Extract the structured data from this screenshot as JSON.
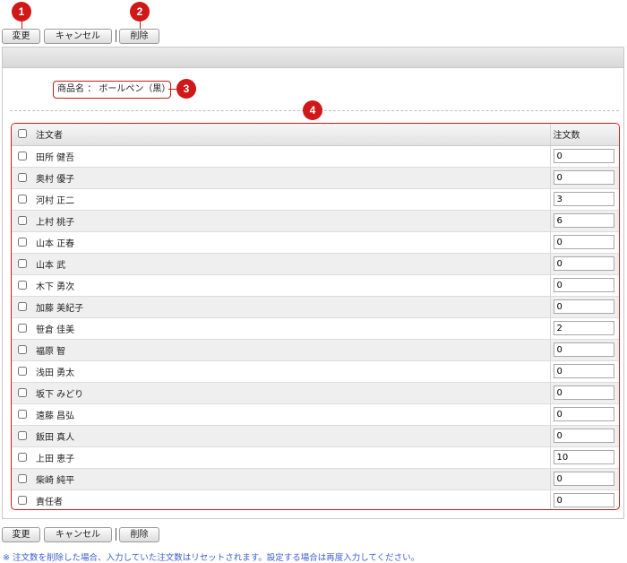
{
  "toolbar": {
    "change_label": "変更",
    "cancel_label": "キャンセル",
    "delete_label": "削除"
  },
  "callouts": [
    "1",
    "2",
    "3",
    "4"
  ],
  "product": {
    "label": "商品名",
    "separator": "：",
    "name": "ボールペン（黒）"
  },
  "table": {
    "headers": {
      "orderer": "注文者",
      "quantity": "注文数"
    },
    "rows": [
      {
        "name": "田所 健吾",
        "qty": "0"
      },
      {
        "name": "奥村 優子",
        "qty": "0"
      },
      {
        "name": "河村 正二",
        "qty": "3"
      },
      {
        "name": "上村 桃子",
        "qty": "6"
      },
      {
        "name": "山本 正春",
        "qty": "0"
      },
      {
        "name": "山本 武",
        "qty": "0"
      },
      {
        "name": "木下 勇次",
        "qty": "0"
      },
      {
        "name": "加藤 美紀子",
        "qty": "0"
      },
      {
        "name": "笹倉 佳美",
        "qty": "2"
      },
      {
        "name": "福原 智",
        "qty": "0"
      },
      {
        "name": "浅田 勇太",
        "qty": "0"
      },
      {
        "name": "坂下 みどり",
        "qty": "0"
      },
      {
        "name": "遠藤 昌弘",
        "qty": "0"
      },
      {
        "name": "飯田 真人",
        "qty": "0"
      },
      {
        "name": "上田 恵子",
        "qty": "10"
      },
      {
        "name": "柴崎 純平",
        "qty": "0"
      },
      {
        "name": "責任者",
        "qty": "0"
      }
    ]
  },
  "note": "※ 注文数を削除した場合、入力していた注文数はリセットされます。設定する場合は再度入力してください。",
  "colors": {
    "callout": "#d01818",
    "note": "#3a5fcd"
  }
}
